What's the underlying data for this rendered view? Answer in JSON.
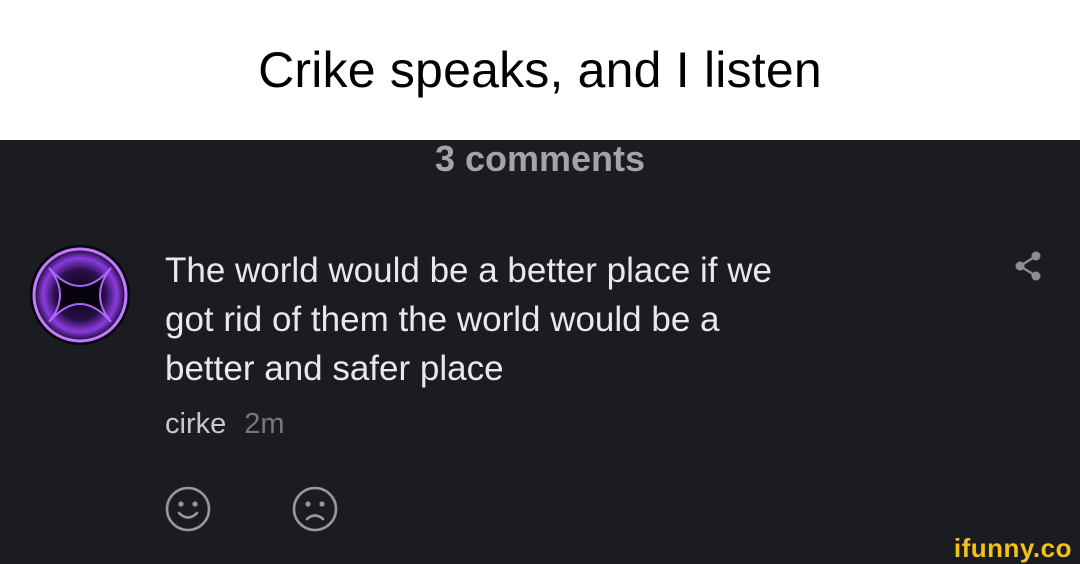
{
  "caption": "Crike speaks, and I listen",
  "comments_header": "3 comments",
  "comment": {
    "text_lines": [
      "The world would be a better place if we",
      "got rid of them the world would be a",
      "better and safer place"
    ],
    "author": "cirke",
    "time": "2m"
  },
  "icons": {
    "share": "share-icon",
    "like": "smile-face-icon",
    "dislike": "frown-face-icon"
  },
  "watermark": "ifunny.co",
  "colors": {
    "panel_bg": "#1b1c21",
    "avatar_glow": "#a64dff",
    "watermark": "#f2c21a"
  }
}
